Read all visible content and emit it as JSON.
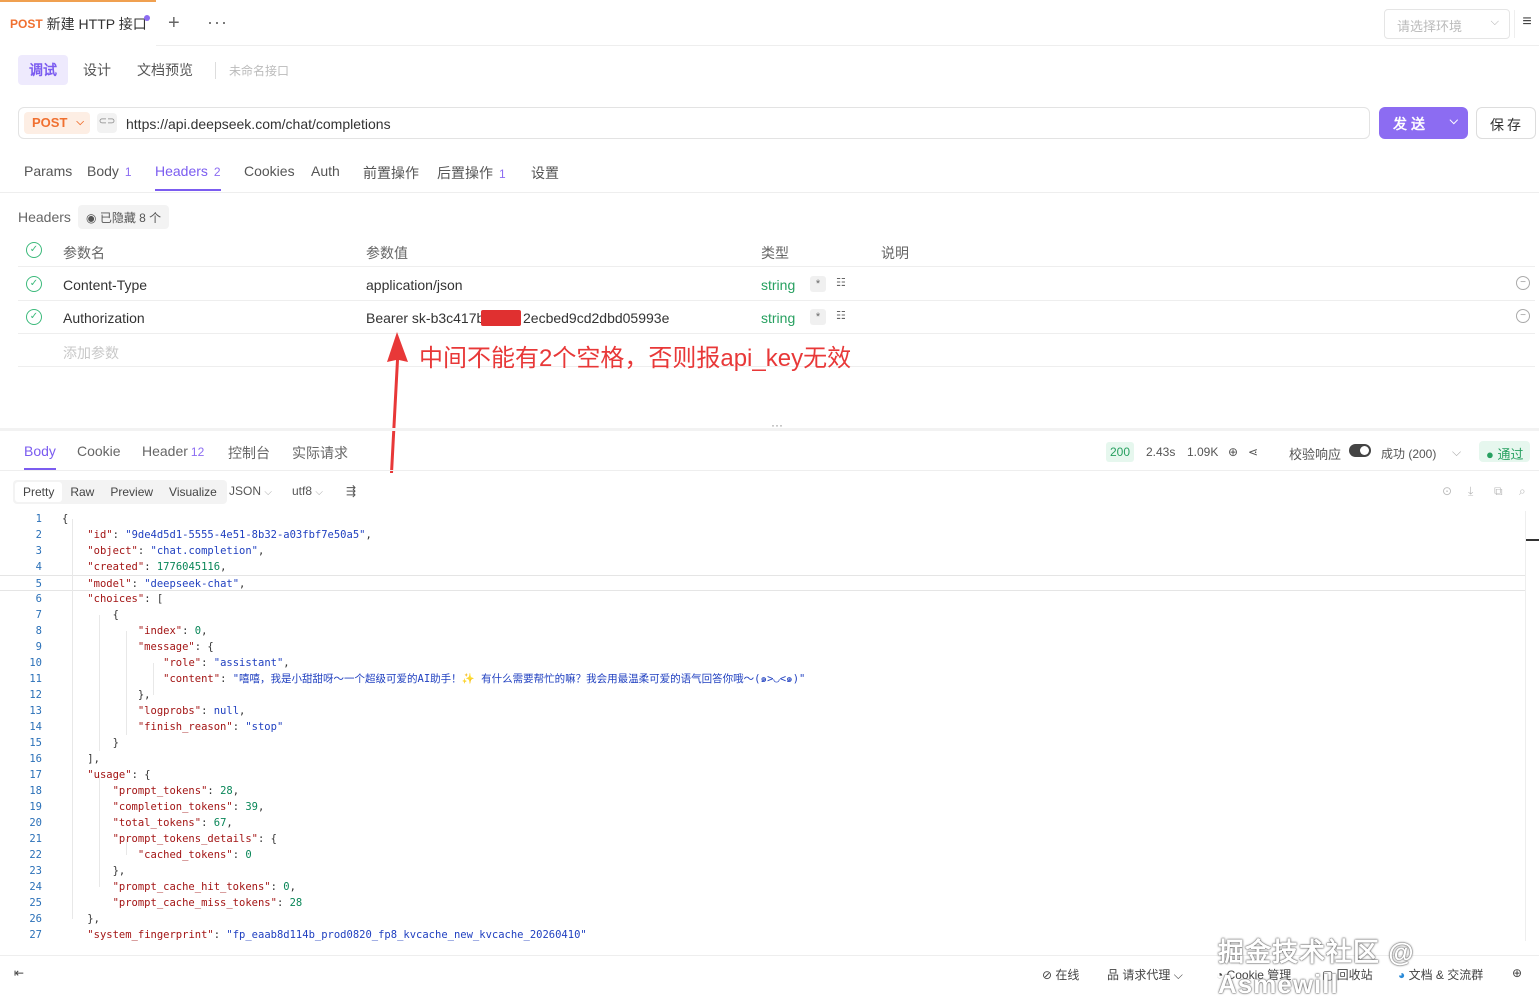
{
  "tab": {
    "method": "POST",
    "title": "新建 HTTP 接口"
  },
  "env": {
    "placeholder": "请选择环境"
  },
  "subtabs": [
    "调试",
    "设计",
    "文档预览"
  ],
  "unnamed": "未命名接口",
  "request": {
    "method": "POST",
    "url": "https://api.deepseek.com/chat/completions",
    "send": "发送",
    "save": "保存"
  },
  "req_tabs": [
    {
      "label": "Params",
      "count": ""
    },
    {
      "label": "Body",
      "count": "1"
    },
    {
      "label": "Headers",
      "count": "2"
    },
    {
      "label": "Cookies",
      "count": ""
    },
    {
      "label": "Auth",
      "count": ""
    },
    {
      "label": "前置操作",
      "count": ""
    },
    {
      "label": "后置操作",
      "count": "1"
    },
    {
      "label": "设置",
      "count": ""
    }
  ],
  "headers": {
    "label": "Headers",
    "hidden": "已隐藏 8 个",
    "columns": [
      "参数名",
      "参数值",
      "类型",
      "说明"
    ],
    "rows": [
      {
        "name": "Content-Type",
        "value": "application/json",
        "type": "string"
      },
      {
        "name": "Authorization",
        "value": "Bearer sk-b3c417b4",
        "value_tail": "2ecbed9cd2dbd05993e",
        "type": "string"
      }
    ],
    "add_placeholder": "添加参数"
  },
  "annotation": "中间不能有2个空格，否则报api_key无效",
  "response": {
    "tabs": [
      {
        "label": "Body",
        "count": ""
      },
      {
        "label": "Cookie",
        "count": ""
      },
      {
        "label": "Header",
        "count": "12"
      },
      {
        "label": "控制台",
        "count": ""
      },
      {
        "label": "实际请求",
        "count": ""
      }
    ],
    "status": "200",
    "time": "2.43s",
    "size": "1.09K",
    "validate_label": "校验响应",
    "result": "成功 (200)",
    "pass": "通过",
    "formats": [
      "Pretty",
      "Raw",
      "Preview",
      "Visualize"
    ],
    "lang": "JSON",
    "encoding": "utf8"
  },
  "code_lines": [
    "{",
    "    \"id\": \"9de4d5d1-5555-4e51-8b32-a03fbf7e50a5\",",
    "    \"object\": \"chat.completion\",",
    "    \"created\": 1776045116,",
    "    \"model\": \"deepseek-chat\",",
    "    \"choices\": [",
    "        {",
    "            \"index\": 0,",
    "            \"message\": {",
    "                \"role\": \"assistant\",",
    "                \"content\": \"嘻嘻，我是小甜甜呀～一个超级可爱的AI助手！✨ 有什么需要帮忙的嘛？我会用最温柔可爱的语气回答你哦～(๑>◡<๑)\"",
    "            },",
    "            \"logprobs\": null,",
    "            \"finish_reason\": \"stop\"",
    "        }",
    "    ],",
    "    \"usage\": {",
    "        \"prompt_tokens\": 28,",
    "        \"completion_tokens\": 39,",
    "        \"total_tokens\": 67,",
    "        \"prompt_tokens_details\": {",
    "            \"cached_tokens\": 0",
    "        },",
    "        \"prompt_cache_hit_tokens\": 0,",
    "        \"prompt_cache_miss_tokens\": 28",
    "    },",
    "    \"system_fingerprint\": \"fp_eaab8d114b_prod0820_fp8_kvcache_new_kvcache_20260410\""
  ],
  "footer": {
    "online": "在线",
    "proxy": "请求代理",
    "cookie": "Cookie 管理",
    "trash": "回收站",
    "docs": "文档 & 交流群"
  },
  "watermark": "掘金技术社区 @ Asmewill",
  "colors": {
    "accent": "#8c6cf2",
    "method": "#f07030",
    "success": "#27a060",
    "annotation": "#e83838"
  }
}
